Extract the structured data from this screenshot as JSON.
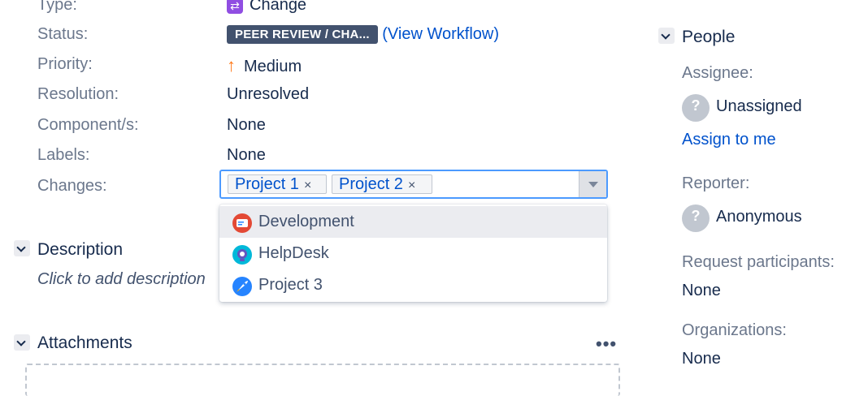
{
  "fields": {
    "type_label": "Type:",
    "type_value": "Change",
    "status_label": "Status:",
    "status_value": "PEER REVIEW / CHA...",
    "status_link": "(View Workflow)",
    "priority_label": "Priority:",
    "priority_value": "Medium",
    "resolution_label": "Resolution:",
    "resolution_value": "Unresolved",
    "components_label": "Component/s:",
    "components_value": "None",
    "labels_label": "Labels:",
    "labels_value": "None",
    "changes_label": "Changes:"
  },
  "changes_select": {
    "selected": [
      "Project 1",
      "Project 2"
    ],
    "remove_glyph": "×"
  },
  "dropdown": {
    "items": [
      "Development",
      "HelpDesk",
      "Project 3"
    ]
  },
  "description": {
    "title": "Description",
    "placeholder": "Click to add description"
  },
  "attachments": {
    "title": "Attachments",
    "more": "•••"
  },
  "people": {
    "title": "People",
    "assignee_label": "Assignee:",
    "assignee_value": "Unassigned",
    "assign_link": "Assign to me",
    "reporter_label": "Reporter:",
    "reporter_value": "Anonymous",
    "participants_label": "Request participants:",
    "participants_value": "None",
    "organizations_label": "Organizations:",
    "organizations_value": "None"
  },
  "icons": {
    "type": "change-type-icon",
    "priority": "arrow-up-icon",
    "development": "development-project-icon",
    "helpdesk": "helpdesk-project-icon",
    "project3": "rocket-project-icon"
  },
  "colors": {
    "accent": "#0052cc",
    "status_bg": "#42526e",
    "priority": "#ff7a1a",
    "focus": "#4c9aff"
  }
}
